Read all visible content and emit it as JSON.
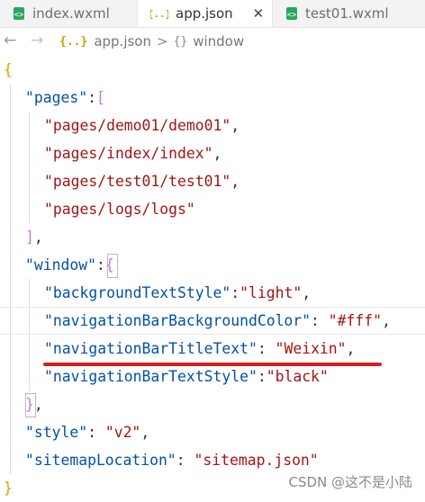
{
  "tabs": [
    {
      "label": "index.wxml",
      "icon": "wxml-file-icon",
      "active": false
    },
    {
      "label": "app.json",
      "icon": "json-file-icon",
      "active": true,
      "close": "✕"
    },
    {
      "label": "test01.wxml",
      "icon": "wxml-file-icon",
      "active": false
    }
  ],
  "breadcrumb": {
    "file_icon": "{..}",
    "file": "app.json",
    "separator": ">",
    "scope_icon": "{}",
    "scope": "window"
  },
  "code": {
    "open_brace": "{",
    "pages_key": "\"pages\"",
    "pages_values": [
      "\"pages/demo01/demo01\"",
      "\"pages/index/index\"",
      "\"pages/test01/test01\"",
      "\"pages/logs/logs\""
    ],
    "window_key": "\"window\"",
    "window_entries": [
      {
        "key": "\"backgroundTextStyle\"",
        "sep": ":",
        "value": "\"light\"",
        "tail": ","
      },
      {
        "key": "\"navigationBarBackgroundColor\"",
        "sep": ": ",
        "value": "\"#fff\"",
        "tail": ","
      },
      {
        "key": "\"navigationBarTitleText\"",
        "sep": ": ",
        "value": "\"Weixin\"",
        "tail": ","
      },
      {
        "key": "\"navigationBarTextStyle\"",
        "sep": ":",
        "value": "\"black\"",
        "tail": ""
      }
    ],
    "style_key": "\"style\"",
    "style_value": "\"v2\"",
    "sitemap_key": "\"sitemapLocation\"",
    "sitemap_value": "\"sitemap.json\"",
    "close_brace": "}"
  },
  "watermark": "CSDN @这不是小陆",
  "colors": {
    "key": "#0451a5",
    "string": "#a31515",
    "brace_outer": "#d4aa00",
    "bracket_inner": "#c678dd",
    "annotation_underline": "#d61f1f"
  }
}
